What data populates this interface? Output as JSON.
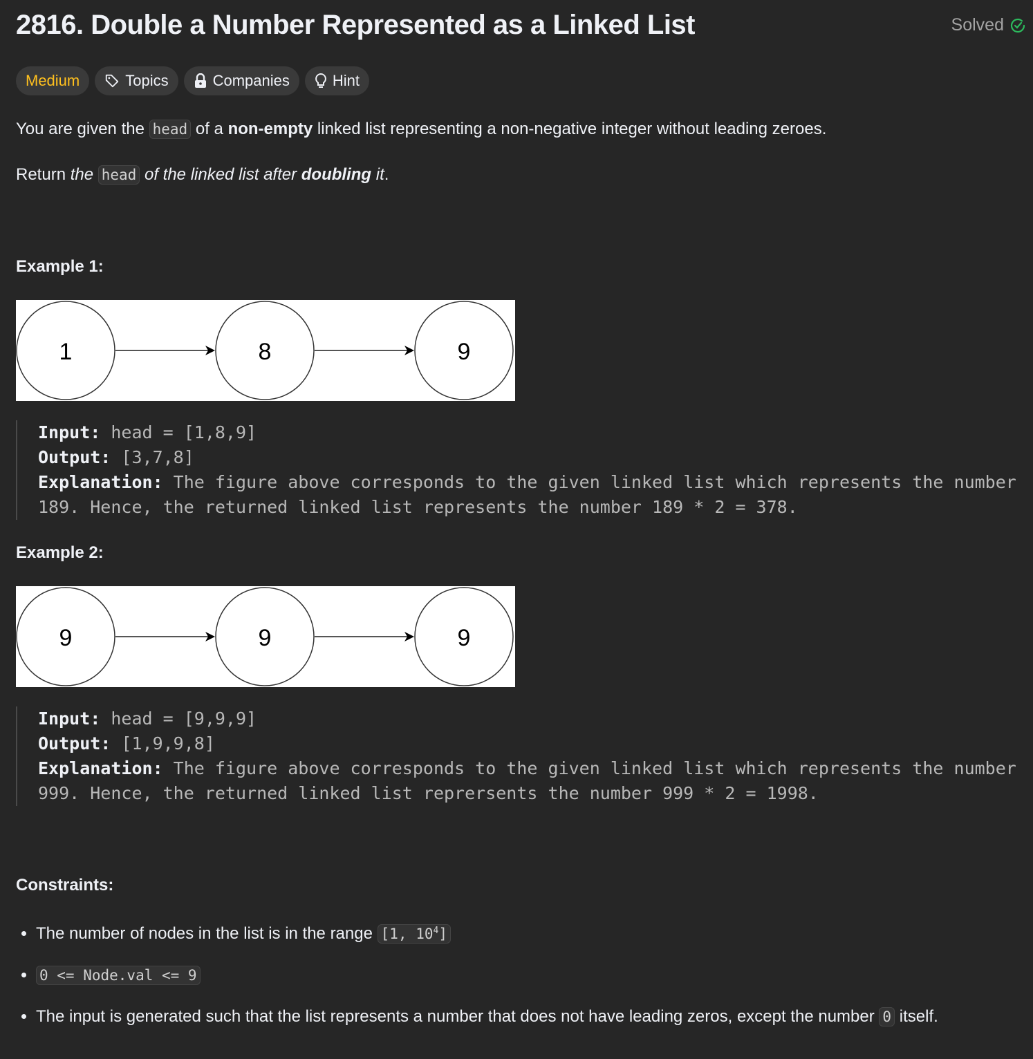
{
  "title": "2816. Double a Number Represented as a Linked List",
  "status": "Solved",
  "tags": {
    "difficulty": "Medium",
    "topics": "Topics",
    "companies": "Companies",
    "hint": "Hint"
  },
  "description": {
    "p1": [
      "You are given the ",
      "head",
      " of a ",
      "non-empty",
      " linked list representing a non-negative integer without leading zeroes."
    ],
    "p2": [
      "Return ",
      "the ",
      "head",
      " of the linked list after ",
      "doubling",
      " it",
      "."
    ]
  },
  "examples": [
    {
      "heading": "Example 1:",
      "nodes": [
        "1",
        "8",
        "9"
      ],
      "input_label": "Input:",
      "input": " head = [1,8,9]",
      "output_label": "Output:",
      "output": " [3,7,8]",
      "explanation_label": "Explanation:",
      "explanation": " The figure above corresponds to the given linked list which represents the number\n189. Hence, the returned linked list represents the number 189 * 2 = 378."
    },
    {
      "heading": "Example 2:",
      "nodes": [
        "9",
        "9",
        "9"
      ],
      "input_label": "Input:",
      "input": " head = [9,9,9]",
      "output_label": "Output:",
      "output": " [1,9,9,8]",
      "explanation_label": "Explanation:",
      "explanation": " The figure above corresponds to the given linked list which represents the number\n999. Hence, the returned linked list reprersents the number 999 * 2 = 1998."
    }
  ],
  "constraints": {
    "heading": "Constraints:",
    "c1_text": "The number of nodes in the list is in the range ",
    "c1_code": "[1, 10",
    "c1_sup": "4",
    "c1_end": "]",
    "c2_code": "0 <= Node.val <= 9",
    "c3_text": "The input is generated such that the list represents a number that does not have leading zeros, except the number ",
    "c3_code": "0",
    "c3_end": " itself."
  },
  "colors": {
    "medium": "#ffc01e",
    "solved": "#2cbb5d"
  }
}
